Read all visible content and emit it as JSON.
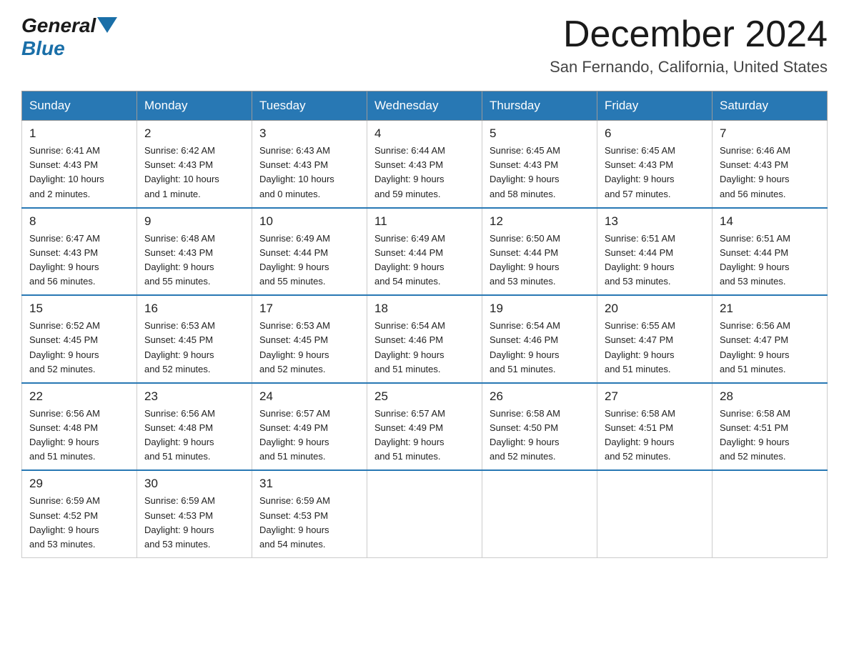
{
  "header": {
    "logo": {
      "general": "General",
      "blue": "Blue"
    },
    "title": "December 2024",
    "location": "San Fernando, California, United States"
  },
  "calendar": {
    "headers": [
      "Sunday",
      "Monday",
      "Tuesday",
      "Wednesday",
      "Thursday",
      "Friday",
      "Saturday"
    ],
    "weeks": [
      [
        {
          "day": "1",
          "sunrise": "6:41 AM",
          "sunset": "4:43 PM",
          "daylight": "10 hours and 2 minutes."
        },
        {
          "day": "2",
          "sunrise": "6:42 AM",
          "sunset": "4:43 PM",
          "daylight": "10 hours and 1 minute."
        },
        {
          "day": "3",
          "sunrise": "6:43 AM",
          "sunset": "4:43 PM",
          "daylight": "10 hours and 0 minutes."
        },
        {
          "day": "4",
          "sunrise": "6:44 AM",
          "sunset": "4:43 PM",
          "daylight": "9 hours and 59 minutes."
        },
        {
          "day": "5",
          "sunrise": "6:45 AM",
          "sunset": "4:43 PM",
          "daylight": "9 hours and 58 minutes."
        },
        {
          "day": "6",
          "sunrise": "6:45 AM",
          "sunset": "4:43 PM",
          "daylight": "9 hours and 57 minutes."
        },
        {
          "day": "7",
          "sunrise": "6:46 AM",
          "sunset": "4:43 PM",
          "daylight": "9 hours and 56 minutes."
        }
      ],
      [
        {
          "day": "8",
          "sunrise": "6:47 AM",
          "sunset": "4:43 PM",
          "daylight": "9 hours and 56 minutes."
        },
        {
          "day": "9",
          "sunrise": "6:48 AM",
          "sunset": "4:43 PM",
          "daylight": "9 hours and 55 minutes."
        },
        {
          "day": "10",
          "sunrise": "6:49 AM",
          "sunset": "4:44 PM",
          "daylight": "9 hours and 55 minutes."
        },
        {
          "day": "11",
          "sunrise": "6:49 AM",
          "sunset": "4:44 PM",
          "daylight": "9 hours and 54 minutes."
        },
        {
          "day": "12",
          "sunrise": "6:50 AM",
          "sunset": "4:44 PM",
          "daylight": "9 hours and 53 minutes."
        },
        {
          "day": "13",
          "sunrise": "6:51 AM",
          "sunset": "4:44 PM",
          "daylight": "9 hours and 53 minutes."
        },
        {
          "day": "14",
          "sunrise": "6:51 AM",
          "sunset": "4:44 PM",
          "daylight": "9 hours and 53 minutes."
        }
      ],
      [
        {
          "day": "15",
          "sunrise": "6:52 AM",
          "sunset": "4:45 PM",
          "daylight": "9 hours and 52 minutes."
        },
        {
          "day": "16",
          "sunrise": "6:53 AM",
          "sunset": "4:45 PM",
          "daylight": "9 hours and 52 minutes."
        },
        {
          "day": "17",
          "sunrise": "6:53 AM",
          "sunset": "4:45 PM",
          "daylight": "9 hours and 52 minutes."
        },
        {
          "day": "18",
          "sunrise": "6:54 AM",
          "sunset": "4:46 PM",
          "daylight": "9 hours and 51 minutes."
        },
        {
          "day": "19",
          "sunrise": "6:54 AM",
          "sunset": "4:46 PM",
          "daylight": "9 hours and 51 minutes."
        },
        {
          "day": "20",
          "sunrise": "6:55 AM",
          "sunset": "4:47 PM",
          "daylight": "9 hours and 51 minutes."
        },
        {
          "day": "21",
          "sunrise": "6:56 AM",
          "sunset": "4:47 PM",
          "daylight": "9 hours and 51 minutes."
        }
      ],
      [
        {
          "day": "22",
          "sunrise": "6:56 AM",
          "sunset": "4:48 PM",
          "daylight": "9 hours and 51 minutes."
        },
        {
          "day": "23",
          "sunrise": "6:56 AM",
          "sunset": "4:48 PM",
          "daylight": "9 hours and 51 minutes."
        },
        {
          "day": "24",
          "sunrise": "6:57 AM",
          "sunset": "4:49 PM",
          "daylight": "9 hours and 51 minutes."
        },
        {
          "day": "25",
          "sunrise": "6:57 AM",
          "sunset": "4:49 PM",
          "daylight": "9 hours and 51 minutes."
        },
        {
          "day": "26",
          "sunrise": "6:58 AM",
          "sunset": "4:50 PM",
          "daylight": "9 hours and 52 minutes."
        },
        {
          "day": "27",
          "sunrise": "6:58 AM",
          "sunset": "4:51 PM",
          "daylight": "9 hours and 52 minutes."
        },
        {
          "day": "28",
          "sunrise": "6:58 AM",
          "sunset": "4:51 PM",
          "daylight": "9 hours and 52 minutes."
        }
      ],
      [
        {
          "day": "29",
          "sunrise": "6:59 AM",
          "sunset": "4:52 PM",
          "daylight": "9 hours and 53 minutes."
        },
        {
          "day": "30",
          "sunrise": "6:59 AM",
          "sunset": "4:53 PM",
          "daylight": "9 hours and 53 minutes."
        },
        {
          "day": "31",
          "sunrise": "6:59 AM",
          "sunset": "4:53 PM",
          "daylight": "9 hours and 54 minutes."
        },
        null,
        null,
        null,
        null
      ]
    ],
    "labels": {
      "sunrise": "Sunrise:",
      "sunset": "Sunset:",
      "daylight": "Daylight:"
    }
  }
}
